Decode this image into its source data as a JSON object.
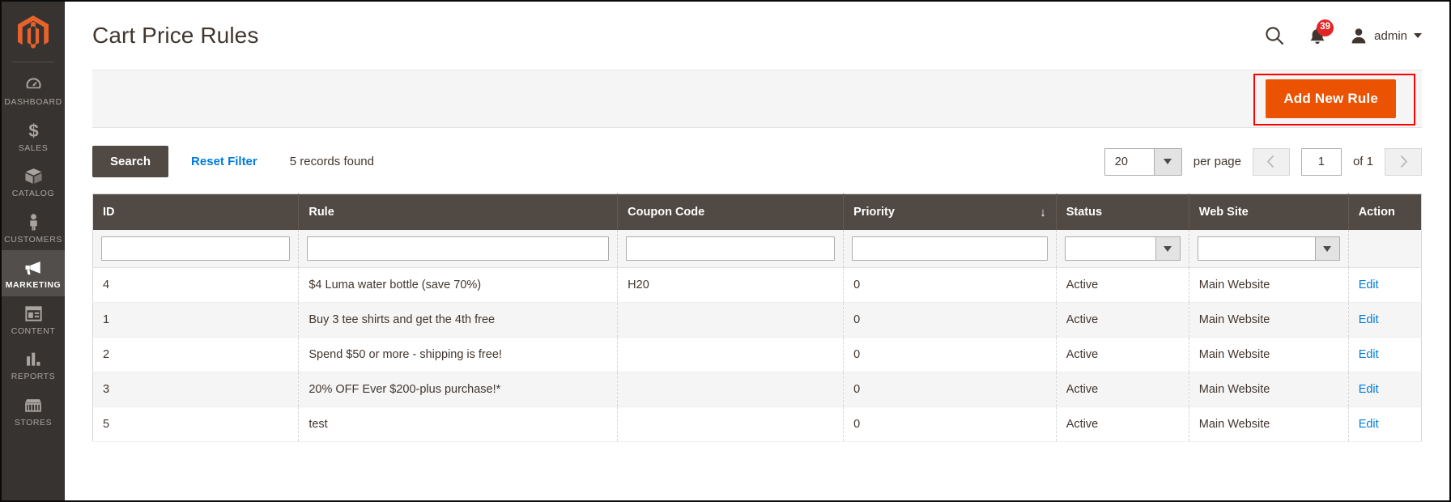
{
  "app": {
    "logo_icon": "magento-logo-icon",
    "accent_orange": "#eb5202",
    "sidebar_bg": "#373330",
    "header_bg": "#514943",
    "link_blue": "#007bdb",
    "badge_red": "#e22626",
    "highlight_red": "#ff0000"
  },
  "sidebar": {
    "items": [
      {
        "label": "DASHBOARD",
        "icon": "dashboard-gauge-icon",
        "active": false
      },
      {
        "label": "SALES",
        "icon": "dollar-sign-icon",
        "active": false
      },
      {
        "label": "CATALOG",
        "icon": "box-icon",
        "active": false
      },
      {
        "label": "CUSTOMERS",
        "icon": "person-icon",
        "active": false
      },
      {
        "label": "MARKETING",
        "icon": "megaphone-icon",
        "active": true
      },
      {
        "label": "CONTENT",
        "icon": "layout-page-icon",
        "active": false
      },
      {
        "label": "REPORTS",
        "icon": "bar-chart-icon",
        "active": false
      },
      {
        "label": "STORES",
        "icon": "storefront-icon",
        "active": false
      }
    ]
  },
  "header": {
    "title": "Cart Price Rules",
    "search_icon": "search-icon",
    "notifications": {
      "icon": "bell-icon",
      "count": "39"
    },
    "account": {
      "avatar_icon": "user-avatar-icon",
      "name": "admin",
      "caret_icon": "chevron-down-icon"
    }
  },
  "action_bar": {
    "add_new_rule_label": "Add New Rule",
    "highlighted": true
  },
  "grid_toolbar": {
    "search_label": "Search",
    "reset_filter_label": "Reset Filter",
    "records_found": "5 records found",
    "per_page_value": "20",
    "per_page_label": "per page",
    "prev_icon": "chevron-left-icon",
    "next_icon": "chevron-right-icon",
    "page_value": "1",
    "of_label": "of 1"
  },
  "grid": {
    "columns": [
      {
        "key": "id",
        "label": "ID",
        "sort": ""
      },
      {
        "key": "rule",
        "label": "Rule",
        "sort": ""
      },
      {
        "key": "coupon",
        "label": "Coupon Code",
        "sort": ""
      },
      {
        "key": "priority",
        "label": "Priority",
        "sort": "↓"
      },
      {
        "key": "status",
        "label": "Status",
        "sort": ""
      },
      {
        "key": "website",
        "label": "Web Site",
        "sort": ""
      },
      {
        "key": "action",
        "label": "Action",
        "sort": ""
      }
    ],
    "filters": {
      "id": "",
      "rule": "",
      "coupon": "",
      "priority": "",
      "status": "",
      "website": ""
    },
    "rows": [
      {
        "id": "4",
        "rule": "$4 Luma water bottle (save 70%)",
        "coupon": "H20",
        "priority": "0",
        "status": "Active",
        "website": "Main Website",
        "action": "Edit"
      },
      {
        "id": "1",
        "rule": "Buy 3 tee shirts and get the 4th free",
        "coupon": "",
        "priority": "0",
        "status": "Active",
        "website": "Main Website",
        "action": "Edit"
      },
      {
        "id": "2",
        "rule": "Spend $50 or more - shipping is free!",
        "coupon": "",
        "priority": "0",
        "status": "Active",
        "website": "Main Website",
        "action": "Edit"
      },
      {
        "id": "3",
        "rule": "20% OFF Ever $200-plus purchase!*",
        "coupon": "",
        "priority": "0",
        "status": "Active",
        "website": "Main Website",
        "action": "Edit"
      },
      {
        "id": "5",
        "rule": "test",
        "coupon": "",
        "priority": "0",
        "status": "Active",
        "website": "Main Website",
        "action": "Edit"
      }
    ]
  }
}
